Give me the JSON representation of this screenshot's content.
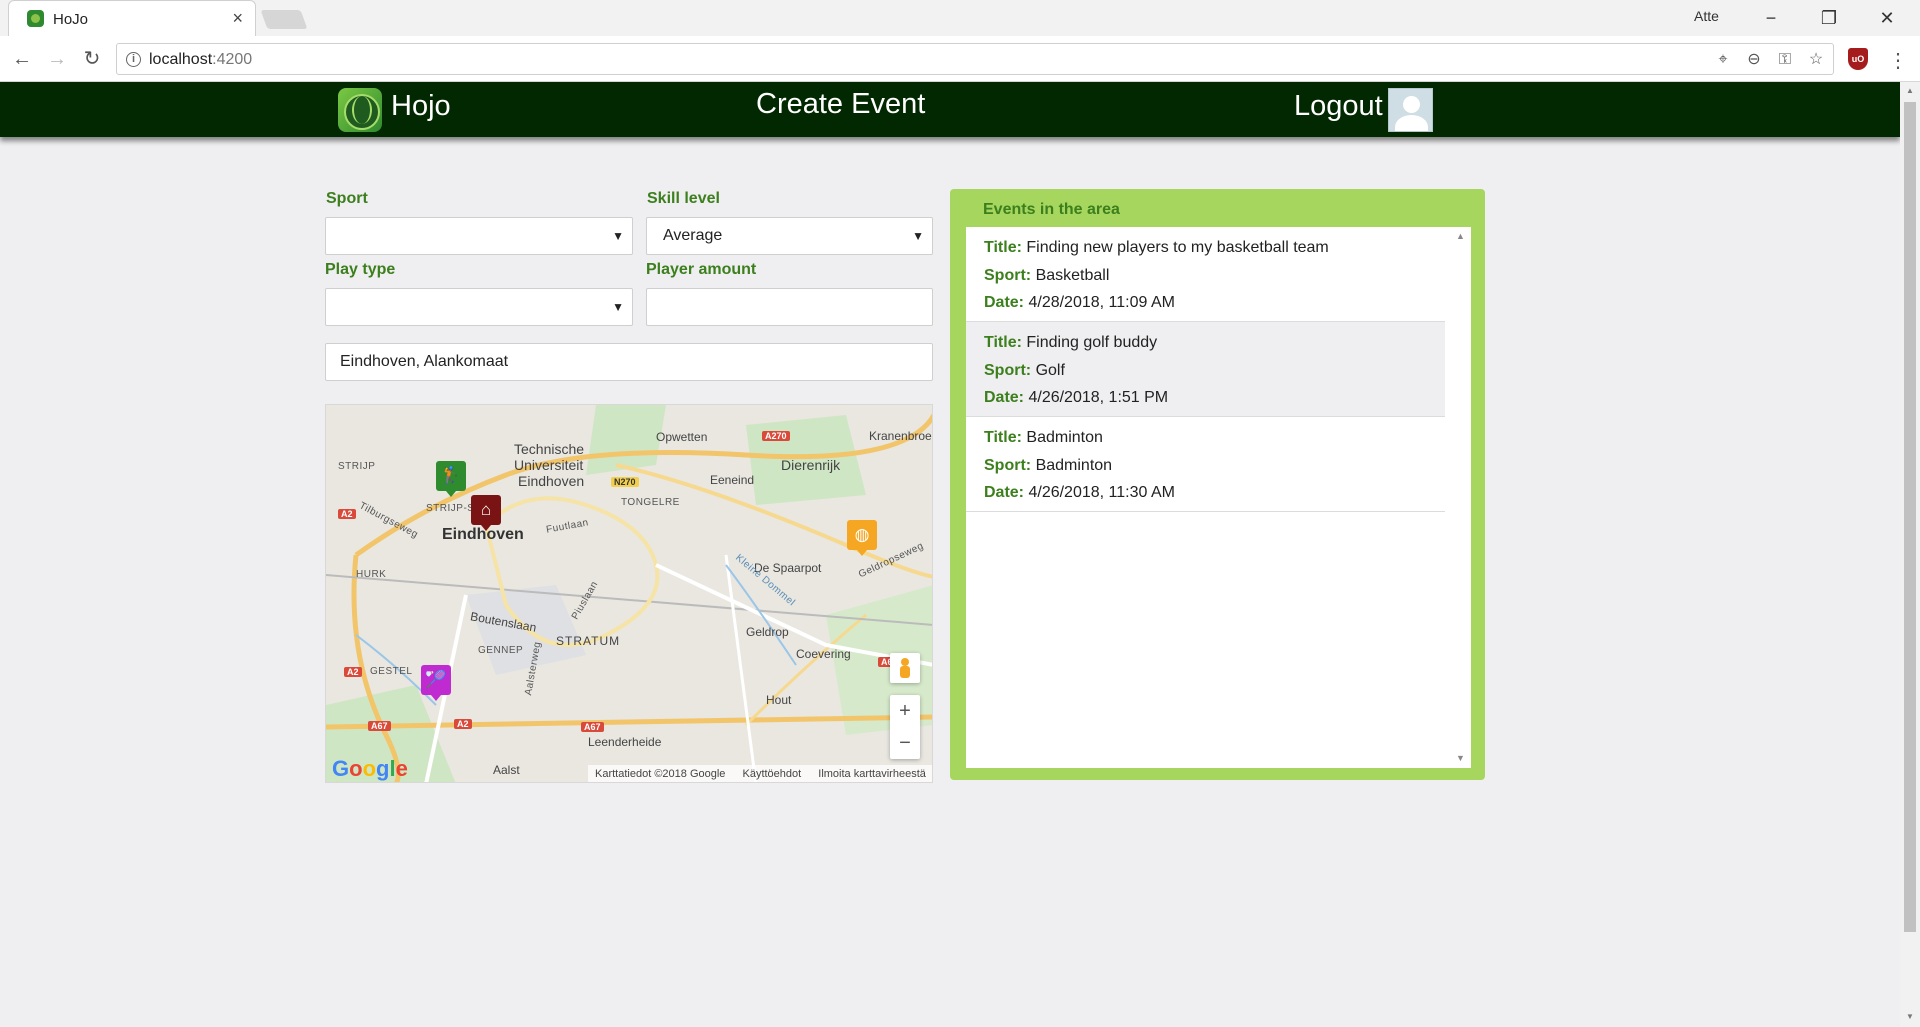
{
  "browser": {
    "tab_title": "HoJo",
    "tab_close": "×",
    "profile_name": "Atte",
    "url_host": "localhost",
    "url_port": ":4200",
    "back": "←",
    "forward": "→",
    "reload": "↻",
    "minimize": "−",
    "restore": "❐",
    "close": "✕",
    "menu": "⋮",
    "location_icon": "⌖",
    "zoom_icon": "⊖",
    "key_icon": "⚿",
    "star_icon": "☆",
    "extension_label": "uO"
  },
  "header": {
    "brand": "Hojo",
    "title": "Create Event",
    "logout": "Logout"
  },
  "form": {
    "sport_label": "Sport",
    "sport_value": "",
    "skill_label": "Skill level",
    "skill_value": "Average",
    "playtype_label": "Play type",
    "playtype_value": "",
    "amount_label": "Player amount",
    "amount_value": "",
    "location_value": "Eindhoven, Alankomaat",
    "caret": "▼"
  },
  "map": {
    "labels": {
      "tu": "Technische",
      "tu2": "Universiteit",
      "tu3": "Eindhoven",
      "eindhoven": "Eindhoven",
      "opwetten": "Opwetten",
      "kranenbroek": "Kranenbroek",
      "dierenrijk": "Dierenrijk",
      "eeneind": "Eeneind",
      "tongelre": "TONGELRE",
      "de_spaarpot": "De Spaarpot",
      "geldrop": "Geldrop",
      "coevering": "Coevering",
      "stratum": "STRATUM",
      "hout": "Hout",
      "leenderheide": "Leenderheide",
      "aalst": "Aalst",
      "strijp": "STRIJP",
      "strijp_s": "STRIJP-S",
      "hurk": "HURK",
      "gestel": "GESTEL",
      "gennep": "GENNEP",
      "boutenslaan": "Boutenslaan",
      "tilburgseweg": "Tilburgseweg",
      "fuutlaan": "Fuutlaan",
      "piuslaan": "Piuslaan",
      "aalsterweg": "Aalsterweg",
      "kleine_dommel": "Kleine Dommel",
      "geldropseweg": "Geldropseweg"
    },
    "shields": {
      "a270": "A270",
      "n270": "N270",
      "a2_top": "A2",
      "a2_mid": "A2",
      "a2_bottom": "A2",
      "a67_left": "A67",
      "a67_right": "A67",
      "a_right": "A6"
    },
    "google": [
      "G",
      "o",
      "o",
      "g",
      "l",
      "e"
    ],
    "footer": {
      "data": "Karttatiedot ©2018 Google",
      "terms": "Käyttöehdot",
      "report": "Ilmoita karttavirheestä"
    },
    "zoom_in": "+",
    "zoom_out": "−",
    "marker_colors": {
      "golf": "#2e8b2e",
      "home": "#7a1414",
      "basketball": "#f5a623",
      "badminton": "#c02ad1"
    },
    "marker_icons": {
      "golf": "🏌",
      "home": "⌂",
      "basketball": "◍",
      "badminton": "🏸"
    }
  },
  "events": {
    "title": "Events in the area",
    "field_title": "Title:",
    "field_sport": "Sport:",
    "field_date": "Date:",
    "items": [
      {
        "title": "Finding new players to my basketball team",
        "sport": "Basketball",
        "date": "4/28/2018, 11:09 AM"
      },
      {
        "title": "Finding golf buddy",
        "sport": "Golf",
        "date": "4/26/2018, 1:51 PM"
      },
      {
        "title": "Badminton",
        "sport": "Badminton",
        "date": "4/26/2018, 11:30 AM"
      }
    ],
    "scroll_up": "▲",
    "scroll_down": "▼"
  },
  "colors": {
    "header_bg": "#012800",
    "accent_green": "#3c7f1d",
    "panel_green": "#a6d65e"
  }
}
